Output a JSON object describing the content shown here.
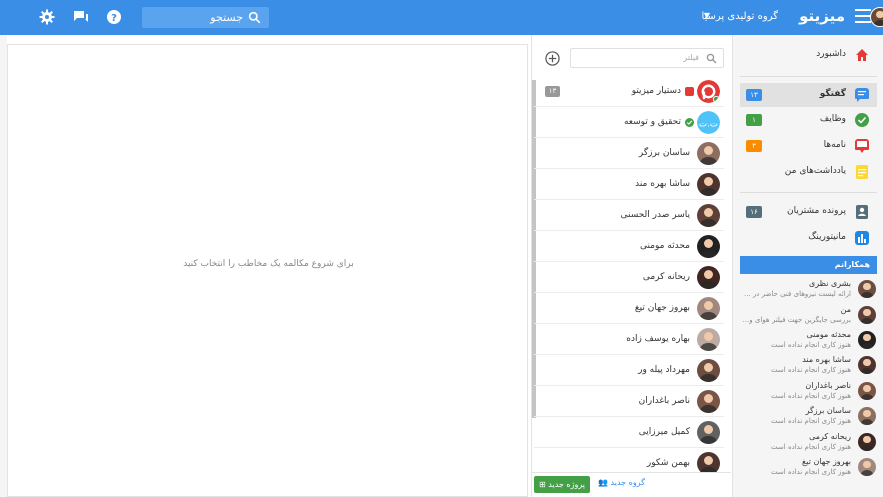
{
  "topbar": {
    "app_name": "میزیتو",
    "organization": "گروه تولیدی پرسیا",
    "search_label": "جستجو"
  },
  "colors": {
    "primary": "#3a8ee6",
    "success": "#43a047",
    "danger": "#e53935",
    "warning": "#fb8c00",
    "note": "#fdd835"
  },
  "sidebar": {
    "items": [
      {
        "label": "داشبورد",
        "icon": "home-icon",
        "badge": ""
      },
      {
        "label": "گفتگو",
        "icon": "chat-icon",
        "badge": "۱۳"
      },
      {
        "label": "وظایف",
        "icon": "check-circle-icon",
        "badge": "۱"
      },
      {
        "label": "نامه‌ها",
        "icon": "inbox-icon",
        "badge": "۳"
      },
      {
        "label": "یادداشت‌های من",
        "icon": "note-icon",
        "badge": ""
      },
      {
        "label": "پرونده مشتریان",
        "icon": "contact-card-icon",
        "badge": "۱۶"
      },
      {
        "label": "مانیتورینگ",
        "icon": "bar-chart-icon",
        "badge": ""
      }
    ],
    "colleagues_title": "همکارانم",
    "colleagues": [
      {
        "name": "بشری نظری",
        "status": "ارائه لیست نیروهای فنی حاضر در ..."
      },
      {
        "name": "من",
        "status": "بررسی جایگزین جهت فیلتر هوای و..."
      },
      {
        "name": "محدثه مومنی",
        "status": "هنوز کاری انجام نداده است"
      },
      {
        "name": "ساشا بهره مند",
        "status": "هنوز کاری انجام نداده است"
      },
      {
        "name": "ناصر باغداران",
        "status": "هنوز کاری انجام نداده است"
      },
      {
        "name": "ساسان برزگر",
        "status": "هنوز کاری انجام نداده است"
      },
      {
        "name": "ریحانه کرمی",
        "status": "هنوز کاری انجام نداده است"
      },
      {
        "name": "بهروز جهان تیغ",
        "status": "هنوز کاری انجام نداده است"
      }
    ]
  },
  "conversations": {
    "filter_placeholder": "فیلتر",
    "items": [
      {
        "name": "دستیار میزیتو",
        "badge": "۱۳"
      },
      {
        "name": "تحقیق و توسعه",
        "badge": ""
      },
      {
        "name": "ساسان برزگر",
        "badge": ""
      },
      {
        "name": "ساشا بهره مند",
        "badge": ""
      },
      {
        "name": "یاسر صدر الحسنی",
        "badge": ""
      },
      {
        "name": "محدثه مومنی",
        "badge": ""
      },
      {
        "name": "ریحانه کرمی",
        "badge": ""
      },
      {
        "name": "بهروز جهان تیغ",
        "badge": ""
      },
      {
        "name": "بهاره یوسف زاده",
        "badge": ""
      },
      {
        "name": "مهرداد پیله ور",
        "badge": ""
      },
      {
        "name": "ناصر باغداران",
        "badge": ""
      },
      {
        "name": "کمیل میرزایی",
        "badge": ""
      },
      {
        "name": "بهمن شکور",
        "badge": ""
      }
    ],
    "new_project_label": "پروژه جدید",
    "new_group_label": "گروه جدید"
  },
  "main": {
    "empty_hint": "برای شروع مکالمه یک مخاطب را انتخاب کنید"
  }
}
